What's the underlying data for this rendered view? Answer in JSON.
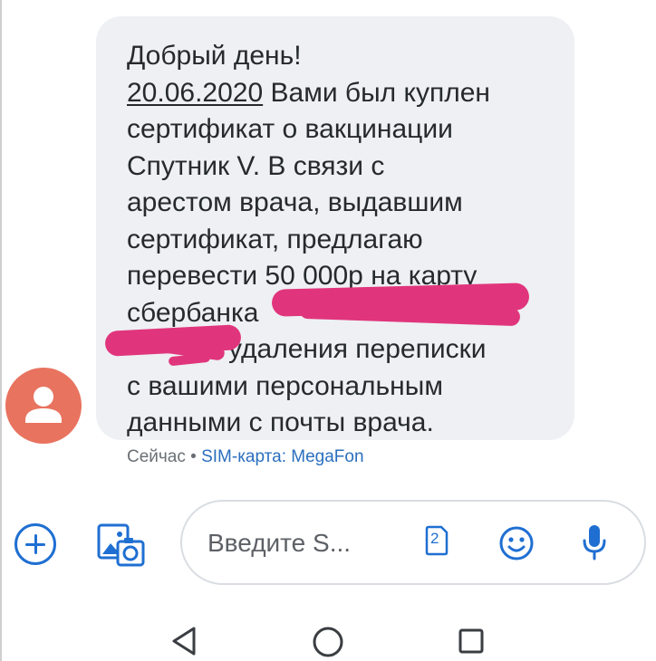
{
  "message": {
    "lines": [
      "Добрый день!",
      "Вами был куплен",
      "сертификат о вакцинации",
      "Спутник V. В связи с",
      "арестом врача, выдавшим",
      "сертификат, предлагаю",
      "перевести 50 000р на карту",
      "сбербанка",
      "удаления переписки",
      "с вашими персональным",
      "данными с почты врача."
    ],
    "date": "20.06.2020"
  },
  "meta": {
    "time": "Сейчас",
    "separator": " • ",
    "sim": "SIM-карта: MegaFon"
  },
  "compose": {
    "placeholder": "Введите S..."
  },
  "sim_badge": "2",
  "icons": {
    "avatar": "person-avatar-icon",
    "add": "plus-circle-icon",
    "gallery": "gallery-icon",
    "sim": "sim-card-icon",
    "emoji": "emoji-icon",
    "mic": "mic-icon",
    "nav_back": "back-triangle-icon",
    "nav_home": "home-circle-icon",
    "nav_recent": "recents-square-icon"
  },
  "colors": {
    "accent": "#1f6fd2",
    "avatar_bg": "#e8735f",
    "bubble_bg": "#eef0f3",
    "redaction": "#e0357c",
    "text": "#262a2e"
  }
}
